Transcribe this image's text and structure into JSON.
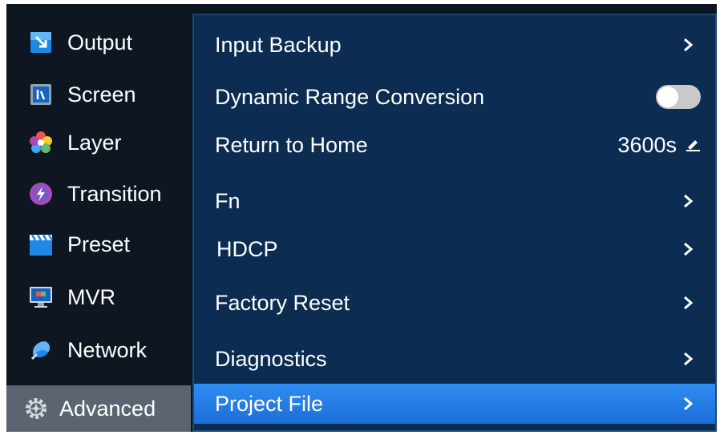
{
  "sidebar": {
    "items": [
      {
        "label": "Output",
        "icon": "output-icon"
      },
      {
        "label": "Screen",
        "icon": "screen-icon"
      },
      {
        "label": "Layer",
        "icon": "layer-icon"
      },
      {
        "label": "Transition",
        "icon": "transition-icon"
      },
      {
        "label": "Preset",
        "icon": "preset-icon"
      },
      {
        "label": "MVR",
        "icon": "mvr-icon"
      },
      {
        "label": "Network",
        "icon": "network-icon"
      },
      {
        "label": "Advanced",
        "icon": "gear-icon"
      }
    ],
    "active": "Advanced"
  },
  "menu": {
    "items": [
      {
        "label": "Input Backup",
        "control": "chevron"
      },
      {
        "label": "Dynamic Range Conversion",
        "control": "toggle",
        "state": "off"
      },
      {
        "label": "Return to Home",
        "control": "value",
        "value": "3600s"
      },
      {
        "label": "Fn",
        "control": "chevron"
      },
      {
        "label": "HDCP",
        "control": "chevron"
      },
      {
        "label": "Factory Reset",
        "control": "chevron"
      },
      {
        "label": "Diagnostics",
        "control": "chevron"
      },
      {
        "label": "Project File",
        "control": "chevron"
      }
    ],
    "selected": "Project File"
  },
  "colors": {
    "sidebar_bg": "#0e1622",
    "panel_bg": "#0c2c52",
    "selected_row": "#2f8cf0",
    "active_sidebar": "#5b6470"
  }
}
